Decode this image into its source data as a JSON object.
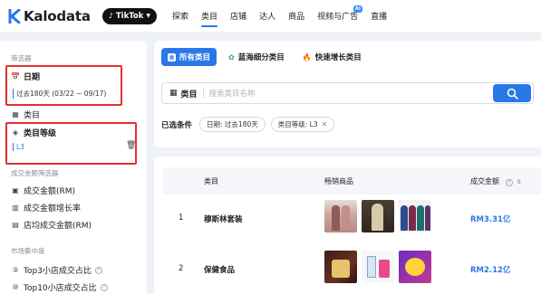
{
  "header": {
    "logo_text": "Kalodata",
    "platform_label": "TikTok",
    "nav": [
      {
        "label": "探索"
      },
      {
        "label": "类目"
      },
      {
        "label": "店铺"
      },
      {
        "label": "达人"
      },
      {
        "label": "商品"
      },
      {
        "label": "视频与广告"
      },
      {
        "label": "直播"
      }
    ],
    "active_nav": "类目",
    "ai_badge": "AI"
  },
  "sidebar": {
    "filter_heading": "筛选器",
    "date_label": "日期",
    "date_value": "过去180天 (03/22 ~ 09/17)",
    "category_label": "类目",
    "level_label": "类目等级",
    "level_value": "L3",
    "gmv_heading": "成交金额筛选器",
    "gmv_items": [
      {
        "label": "成交金额(RM)",
        "icon": "money-icon"
      },
      {
        "label": "成交金额增长率",
        "icon": "bar-chart-icon"
      },
      {
        "label": "店均成交金额(RM)",
        "icon": "shop-icon"
      }
    ],
    "concentration_heading": "市场集中度",
    "concentration_items": [
      {
        "label": "Top3小店成交占比"
      },
      {
        "label": "Top10小店成交占比"
      }
    ]
  },
  "tabs": [
    {
      "label": "所有类目",
      "icon": "grid-icon",
      "active": true
    },
    {
      "label": "蓝海细分类目",
      "icon": "sprout-icon",
      "active": false
    },
    {
      "label": "快速增长类目",
      "icon": "fire-icon",
      "active": false
    }
  ],
  "search": {
    "category_label": "类目",
    "placeholder": "搜索类目名称"
  },
  "conditions": {
    "label": "已选条件",
    "chips": [
      "日期: 过去180天",
      "类目等级: L3"
    ]
  },
  "table": {
    "headers": {
      "category": "类目",
      "best_sellers": "畅销商品",
      "gmv": "成交金额"
    },
    "rows": [
      {
        "rank": "1",
        "category": "穆斯林套装",
        "gmv": "RM3.31亿"
      },
      {
        "rank": "2",
        "category": "保健食品",
        "gmv": "RM2.12亿"
      }
    ]
  },
  "colors": {
    "accent": "#2a78e8",
    "highlight_box": "#e5302c"
  }
}
